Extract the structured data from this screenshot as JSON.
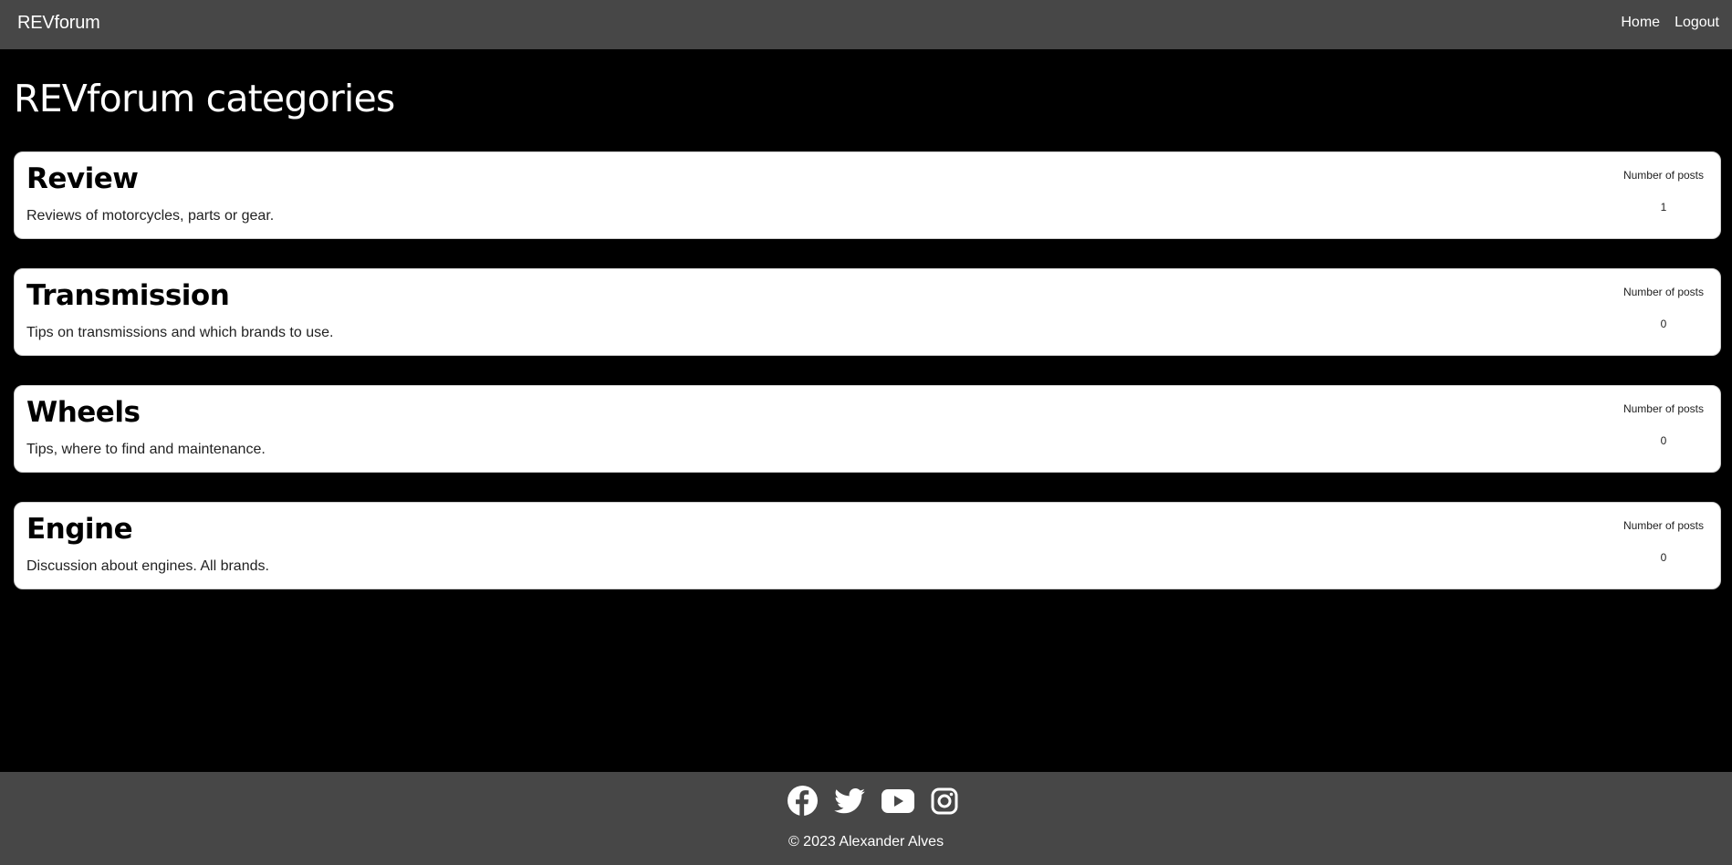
{
  "navbar": {
    "brand": "REVforum",
    "links": [
      {
        "label": "Home"
      },
      {
        "label": "Logout"
      }
    ]
  },
  "page": {
    "title": "REVforum categories"
  },
  "categories": [
    {
      "name": "Review",
      "description": "Reviews of motorcycles, parts or gear.",
      "posts_label": "Number of posts",
      "posts_count": "1"
    },
    {
      "name": "Transmission",
      "description": "Tips on transmissions and which brands to use.",
      "posts_label": "Number of posts",
      "posts_count": "0"
    },
    {
      "name": "Wheels",
      "description": "Tips, where to find and maintenance.",
      "posts_label": "Number of posts",
      "posts_count": "0"
    },
    {
      "name": "Engine",
      "description": "Discussion about engines. All brands.",
      "posts_label": "Number of posts",
      "posts_count": "0"
    }
  ],
  "footer": {
    "social_icons": [
      "facebook-icon",
      "twitter-icon",
      "youtube-icon",
      "instagram-icon"
    ],
    "copyright": "© 2023 Alexander Alves"
  },
  "colors": {
    "background": "#000000",
    "bars": "#474747",
    "card": "#ffffff",
    "text_light": "#ffffff"
  }
}
